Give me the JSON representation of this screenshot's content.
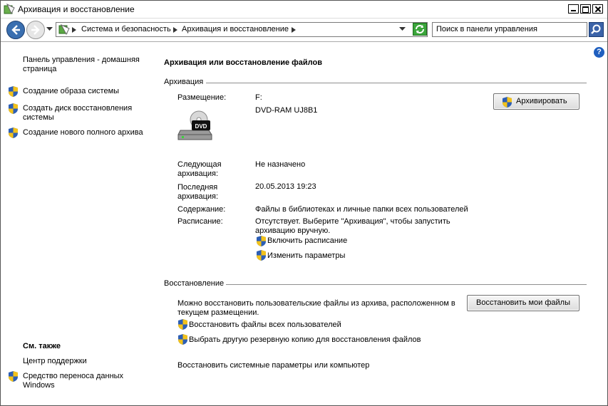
{
  "window": {
    "title": "Архивация и восстановление"
  },
  "nav": {
    "breadcrumbs": [
      "Система и безопасность",
      "Архивация и восстановление"
    ],
    "search_placeholder": "Поиск в панели управления"
  },
  "sidebar": {
    "home_link": "Панель управления - домашняя страница",
    "items": [
      {
        "label": "Создание образа системы",
        "icon": "shield-icon"
      },
      {
        "label": "Создать диск восстановления системы",
        "icon": "shield-icon"
      },
      {
        "label": "Создание нового полного архива",
        "icon": "shield-icon"
      }
    ],
    "see_also_title": "См. также",
    "see_also": [
      {
        "label": "Центр поддержки"
      },
      {
        "label": "Средство переноса данных Windows",
        "icon": "shield-icon"
      }
    ]
  },
  "main": {
    "title": "Архивация или восстановление файлов",
    "backup": {
      "section_title": "Архивация",
      "location_label": "Размещение:",
      "location_drive": "F:",
      "location_device": "DVD-RAM UJ8B1",
      "backup_button": "Архивировать",
      "next_label": "Следующая архивация:",
      "next_value": "Не назначено",
      "last_label": "Последняя архивация:",
      "last_value": "20.05.2013 19:23",
      "contents_label": "Содержание:",
      "contents_value": "Файлы в библиотеках и личные папки всех пользователей",
      "schedule_label": "Расписание:",
      "schedule_value": "Отсутствует. Выберите \"Архивация\", чтобы запустить архивацию вручную.",
      "enable_schedule": "Включить расписание",
      "change_settings": "Изменить параметры"
    },
    "restore": {
      "section_title": "Восстановление",
      "description": "Можно восстановить пользовательские файлы из архива, расположенном в текущем размещении.",
      "restore_button": "Восстановить мои файлы",
      "restore_all_users": "Восстановить файлы всех пользователей",
      "select_another": "Выбрать другую резервную копию для восстановления файлов",
      "recover_system": "Восстановить системные параметры или компьютер"
    }
  },
  "colors": {
    "shield_blue": "#2d5fb5",
    "shield_yellow": "#f2c21b",
    "link": "#000000"
  }
}
